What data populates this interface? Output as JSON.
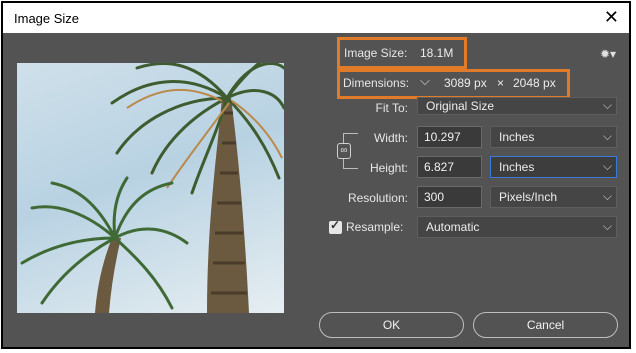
{
  "window": {
    "title": "Image Size",
    "close_icon": "close-icon"
  },
  "image_size": {
    "label": "Image Size:",
    "value": "18.1M"
  },
  "dimensions": {
    "label": "Dimensions:",
    "width": "3089 px",
    "times": "×",
    "height": "2048 px"
  },
  "fit_to": {
    "label": "Fit To:",
    "value": "Original Size"
  },
  "width": {
    "label": "Width:",
    "value": "10.297",
    "unit": "Inches"
  },
  "height": {
    "label": "Height:",
    "value": "6.827",
    "unit": "Inches"
  },
  "resolution": {
    "label": "Resolution:",
    "value": "300",
    "unit": "Pixels/Inch"
  },
  "resample": {
    "label": "Resample:",
    "checked": true,
    "value": "Automatic"
  },
  "buttons": {
    "ok": "OK",
    "cancel": "Cancel"
  },
  "colors": {
    "dialog_bg": "#535353",
    "highlight": "#e07b2a",
    "active_border": "#3b7bd6"
  },
  "icons": [
    "close-icon",
    "gear-icon",
    "chevron-down-icon",
    "chain-link-icon",
    "checkbox-icon"
  ]
}
